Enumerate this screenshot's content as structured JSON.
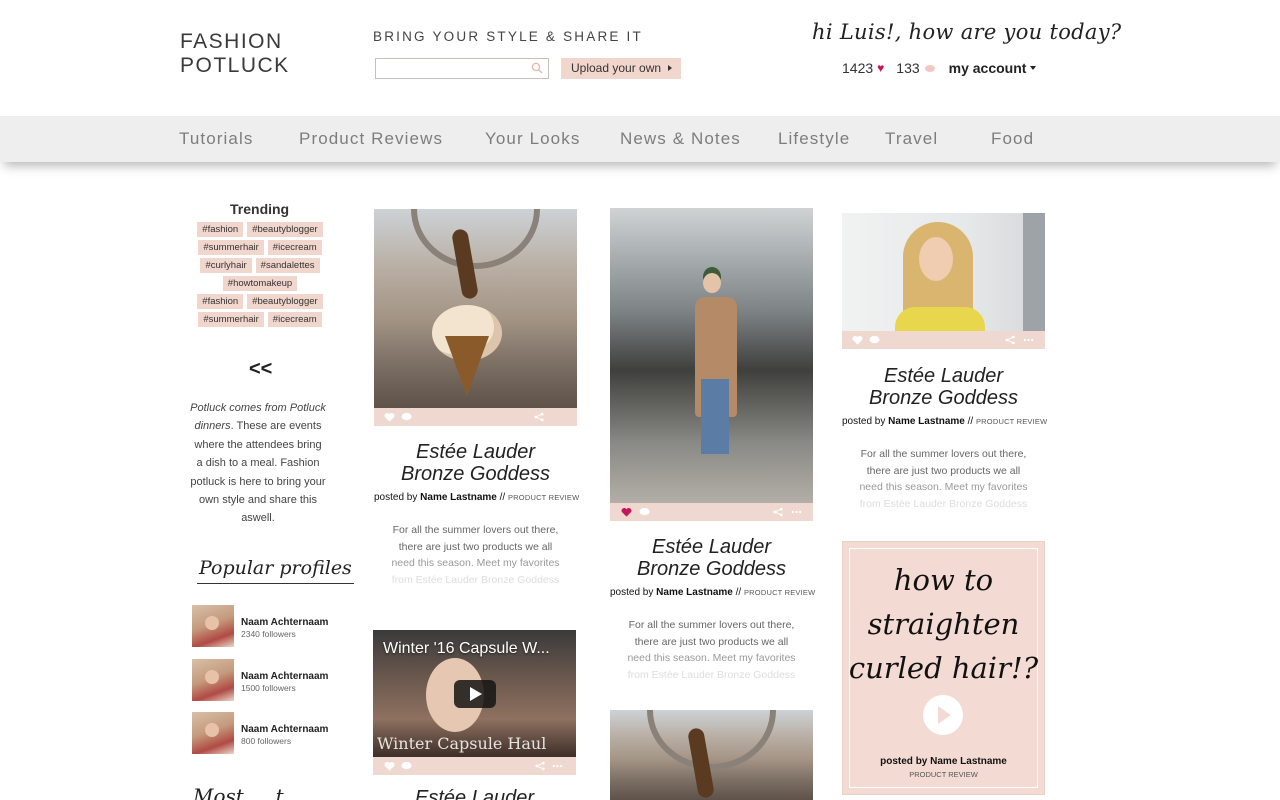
{
  "header": {
    "logo_line1": "FASHION",
    "logo_line2": "POTLUCK",
    "tagline": "BRING YOUR STYLE & SHARE IT",
    "search_placeholder": "",
    "upload_label": "Upload your own",
    "greeting": "hi Luis!, how are you today?",
    "likes_count": "1423",
    "comments_count": "133",
    "account_label": "my account"
  },
  "nav": [
    {
      "label": "Tutorials"
    },
    {
      "label": "Product Reviews"
    },
    {
      "label": "Your Looks"
    },
    {
      "label": "News & Notes"
    },
    {
      "label": "Lifestyle"
    },
    {
      "label": "Travel"
    },
    {
      "label": "Food"
    }
  ],
  "sidebar": {
    "trending_title": "Trending",
    "tag_rows": [
      [
        "#fashion",
        "#beautyblogger"
      ],
      [
        "#summerhair",
        "#icecream"
      ],
      [
        "#curlyhair",
        "#sandalettes"
      ],
      [
        "#howtomakeup"
      ],
      [
        "#fashion",
        "#beautyblogger"
      ],
      [
        "#summerhair",
        "#icecream"
      ]
    ],
    "back_label": "<<",
    "about_lead": "Potluck comes from",
    "about_em": "Potluck dinners",
    "about_rest": ". These are events where the attendees bring a dish to a meal. Fashion potluck is here to bring your own style and share this aswell.",
    "popular_title": "Popular profiles",
    "profiles": [
      {
        "name": "Naam Achternaam",
        "followers": "2340 followers"
      },
      {
        "name": "Naam Achternaam",
        "followers": "1500 followers"
      },
      {
        "name": "Naam Achternaam",
        "followers": "800 followers"
      }
    ],
    "more_title": "Most ... t"
  },
  "cards": {
    "title_line1": "Estée Lauder",
    "title_line2": "Bronze Goddess",
    "posted_prefix": "posted by ",
    "author": "Name Lastname",
    "separator": " // ",
    "category": "PRODUCT REVIEW",
    "excerpt_l1": "For all the summer lovers out there,",
    "excerpt_l2": "there are just two products we all",
    "excerpt_l3": "need this season. Meet my favorites",
    "excerpt_l4": "from Estée Lauder Bronze Goddess",
    "video_title": "Winter '16 Capsule W...",
    "video_caption": "Winter Capsule Haul",
    "bottom_title": "Estée Lauder",
    "howto_l1": "how to",
    "howto_l2": "straighten",
    "howto_l3": "curled hair!?",
    "howto_posted": "posted by Name Lastname",
    "howto_category": "PRODUCT REVIEW"
  },
  "colors": {
    "accent_pink": "#f1d6cd",
    "heart_red": "#c2185b",
    "nav_bg": "#eeeeee"
  },
  "icons": [
    "search-icon",
    "heart-icon",
    "comment-icon",
    "share-icon",
    "more-icon",
    "play-icon",
    "chevron-right-icon",
    "chevron-down-icon"
  ]
}
